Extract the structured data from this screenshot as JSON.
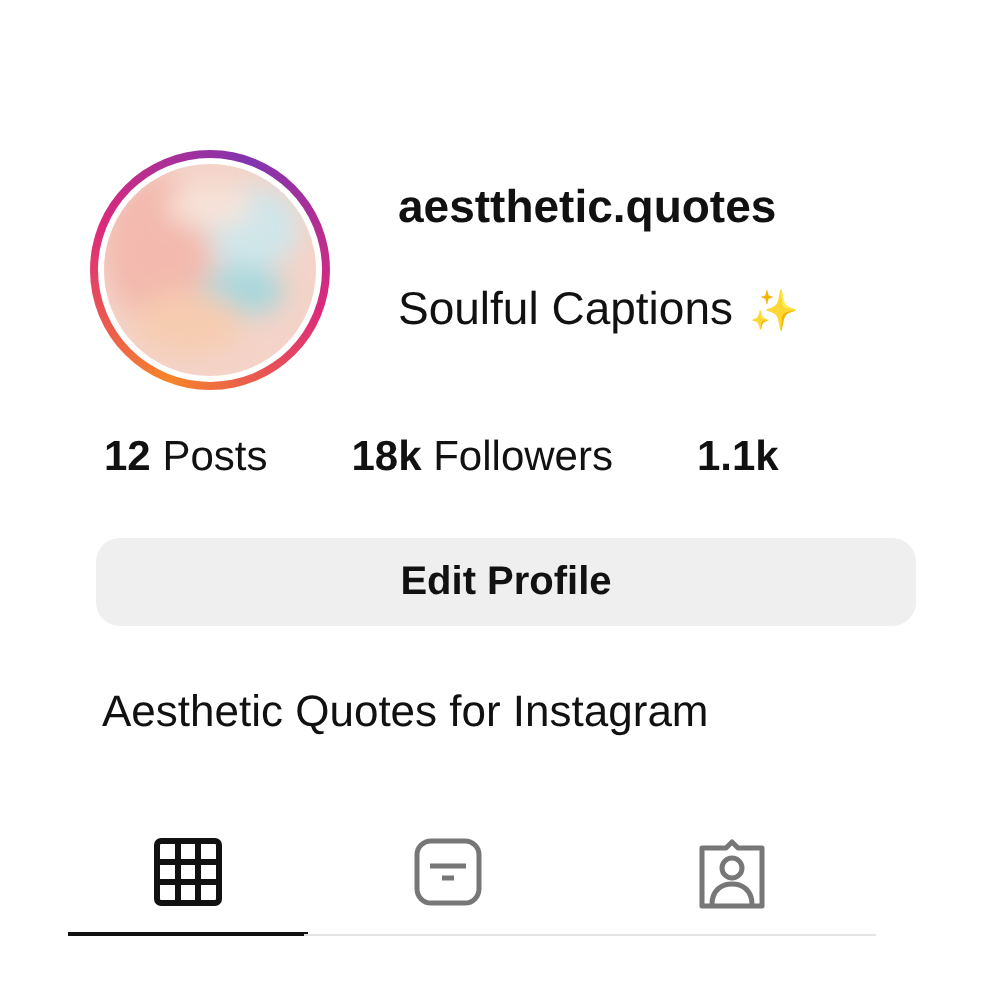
{
  "profile": {
    "username": "aestthetic.quotes",
    "caption": "Soulful Captions",
    "caption_emoji": "✨",
    "avatar": {
      "kind": "picture",
      "story_ring": true
    }
  },
  "stats": [
    {
      "value": "12",
      "label": "Posts"
    },
    {
      "value": "18k",
      "label": "Followers"
    },
    {
      "value": "1.1k"
    }
  ],
  "edit_button": "Edit Profile",
  "bio": "Aesthetic Quotes for Instagram",
  "tabs": [
    {
      "kind": "grid",
      "selected": true
    },
    {
      "kind": "feed",
      "selected": false
    },
    {
      "kind": "tagged",
      "selected": false
    }
  ]
}
